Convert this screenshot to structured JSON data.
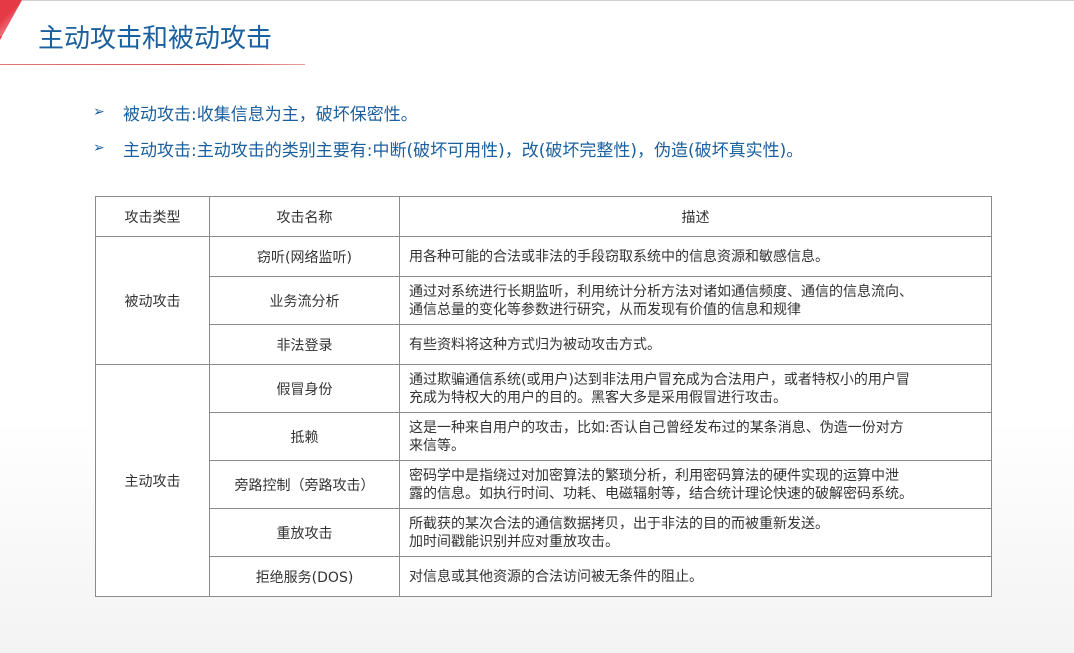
{
  "page": {
    "title": "主动攻击和被动攻击",
    "accent_color": "#e63946",
    "title_color": "#1a5f9e"
  },
  "bullets": [
    {
      "icon": "arrowhead-bullet-icon",
      "text": "被动攻击:收集信息为主，破坏保密性。"
    },
    {
      "icon": "arrowhead-bullet-icon",
      "text": "主动攻击:主动攻击的类别主要有:中断(破坏可用性)，改(破坏完整性)，伪造(破坏真实性)。"
    }
  ],
  "table": {
    "headers": {
      "category": "攻击类型",
      "name": "攻击名称",
      "desc": "描述"
    },
    "groups": [
      {
        "category": "被动攻击",
        "rows": [
          {
            "name": "窃听(网络监听)",
            "desc": [
              "用各种可能的合法或非法的手段窃取系统中的信息资源和敏感信息。"
            ]
          },
          {
            "name": "业务流分析",
            "desc": [
              "通过对系统进行长期监听，利用统计分析方法对诸如通信频度、通信的信息流向、",
              "通信总量的变化等参数进行研究，从而发现有价值的信息和规律"
            ]
          },
          {
            "name": "非法登录",
            "desc": [
              "有些资料将这种方式归为被动攻击方式。"
            ]
          }
        ]
      },
      {
        "category": "主动攻击",
        "rows": [
          {
            "name": "假冒身份",
            "desc": [
              "通过欺骗通信系统(或用户)达到非法用户冒充成为合法用户，或者特权小的用户冒",
              "充成为特权大的用户的目的。黑客大多是采用假冒进行攻击。"
            ]
          },
          {
            "name": "抵赖",
            "desc": [
              "这是一种来自用户的攻击，比如:否认自己曾经发布过的某条消息、伪造一份对方",
              "来信等。"
            ]
          },
          {
            "name": "旁路控制（旁路攻击）",
            "desc": [
              "密码学中是指绕过对加密算法的繁琐分析，利用密码算法的硬件实现的运算中泄",
              "露的信息。如执行时间、功耗、电磁辐射等，结合统计理论快速的破解密码系统。"
            ]
          },
          {
            "name": "重放攻击",
            "desc": [
              "所截获的某次合法的通信数据拷贝，出于非法的目的而被重新发送。",
              "加时间戳能识别并应对重放攻击。"
            ]
          },
          {
            "name": "拒绝服务(DOS)",
            "desc": [
              "对信息或其他资源的合法访问被无条件的阻止。"
            ]
          }
        ]
      }
    ]
  }
}
